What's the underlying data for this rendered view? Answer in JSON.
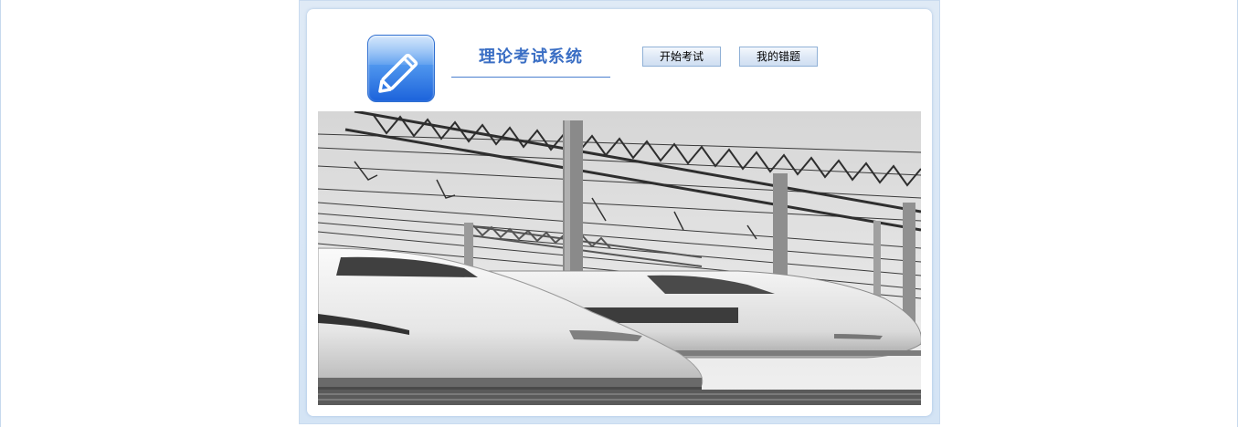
{
  "app": {
    "title": "理论考试系统"
  },
  "toolbar": {
    "start_exam_label": "开始考试",
    "wrong_questions_label": "我的错题"
  },
  "logo": {
    "icon": "pencil-icon"
  },
  "banner": {
    "subject": "high-speed-train-photo",
    "style": "grayscale"
  },
  "colors": {
    "accent": "#3a6ec4",
    "frame": "#d4e4f5",
    "button_border": "#8fb0d6"
  }
}
